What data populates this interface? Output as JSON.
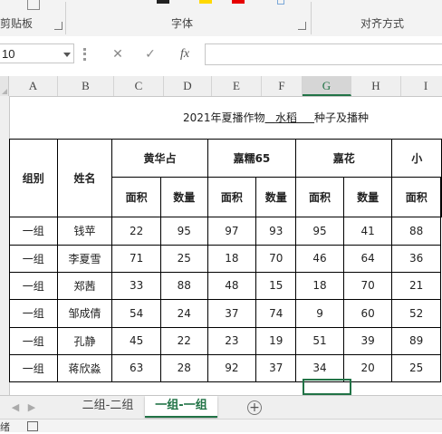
{
  "ribbon": {
    "clipboard_label": "剪贴板",
    "font_label": "字体",
    "align_label": "对齐方式",
    "colors": {
      "highlight": "#ffd800",
      "font_red": "#e60000"
    }
  },
  "formula_bar": {
    "name_box_value": "10",
    "cancel_icon": "✕",
    "confirm_icon": "✓",
    "fx_label": "fx",
    "formula_value": ""
  },
  "columns": [
    "A",
    "B",
    "C",
    "D",
    "E",
    "F",
    "G",
    "H",
    "I"
  ],
  "selected_column": "G",
  "sheet": {
    "title_prefix": "2021年夏播作物",
    "title_crop": "水稻",
    "title_suffix": "种子及播种",
    "header_group": "组别",
    "header_name": "姓名",
    "varieties": [
      "黄华占",
      "嘉糯65",
      "嘉花",
      "小"
    ],
    "area_label": "面积",
    "qty_label": "数量",
    "rows": [
      {
        "group": "一组",
        "name": "钱苹",
        "vals": [
          "22",
          "95",
          "97",
          "93",
          "95",
          "41",
          "88"
        ]
      },
      {
        "group": "一组",
        "name": "李夏雪",
        "vals": [
          "71",
          "25",
          "18",
          "70",
          "46",
          "64",
          "36"
        ]
      },
      {
        "group": "一组",
        "name": "郑茜",
        "vals": [
          "33",
          "88",
          "48",
          "15",
          "18",
          "70",
          "21"
        ]
      },
      {
        "group": "一组",
        "name": "邹成倩",
        "vals": [
          "54",
          "24",
          "37",
          "74",
          "9",
          "60",
          "52"
        ]
      },
      {
        "group": "一组",
        "name": "孔静",
        "vals": [
          "45",
          "22",
          "23",
          "19",
          "51",
          "39",
          "89"
        ]
      },
      {
        "group": "一组",
        "name": "蒋欣淼",
        "vals": [
          "63",
          "28",
          "92",
          "37",
          "34",
          "20",
          "25"
        ]
      }
    ]
  },
  "tabs": {
    "prev_icon": "◀",
    "next_icon": "▶",
    "items": [
      "二组-二组",
      "一组-一组"
    ],
    "active_index": 1,
    "add_icon": "+"
  },
  "status": {
    "text": "绪"
  }
}
